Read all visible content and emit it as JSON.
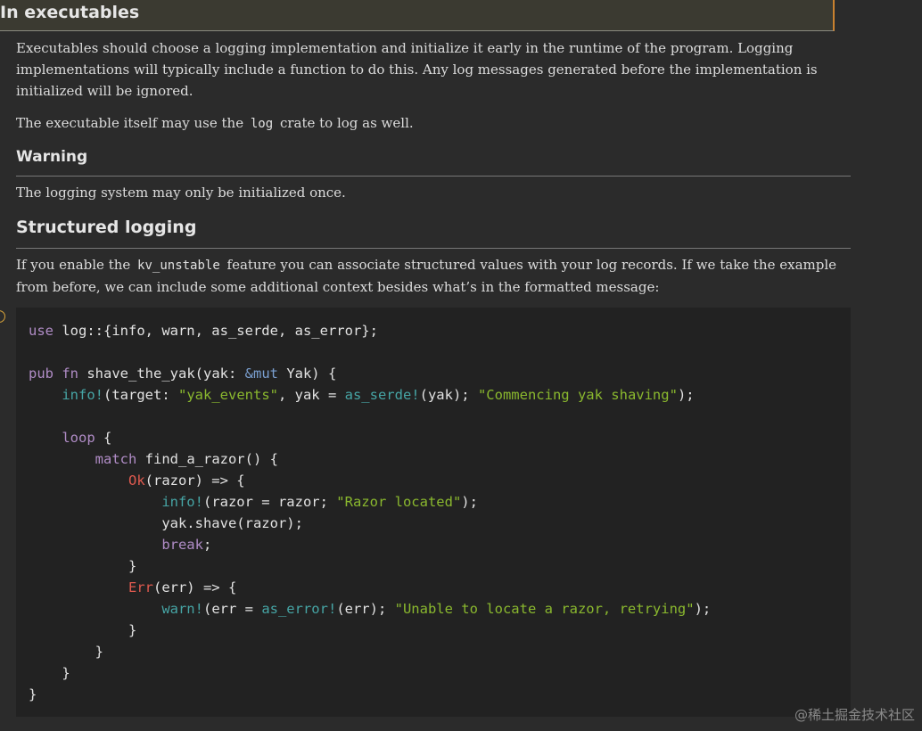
{
  "sections": {
    "executables_heading": "In executables",
    "executables_p1": "Executables should choose a logging implementation and initialize it early in the runtime of the program. Logging implementations will typically include a function to do this. Any log messages generated before the implementation is initialized will be ignored.",
    "executables_p2_before": "The executable itself may use the ",
    "executables_p2_code": "log",
    "executables_p2_after": " crate to log as well.",
    "warning_heading": "Warning",
    "warning_p": "The logging system may only be initialized once.",
    "structured_heading": "Structured logging",
    "structured_p_before": "If you enable the ",
    "structured_p_code": "kv_unstable",
    "structured_p_after": " feature you can associate structured values with your log records. If we take the example from before, we can include some additional context besides what’s in the formatted message:"
  },
  "code": {
    "l1": "use log::{info, warn, as_serde, as_error};",
    "l2_pub": "pub",
    "l2_fn": "fn",
    "l2_name": " shave_the_yak(yak: ",
    "l2_amp": "&mut",
    "l2_rest": " Yak) {",
    "l3_info": "info!",
    "l3_a": "(target: ",
    "l3_target": "\"yak_events\"",
    "l3_b": ", yak = ",
    "l3_serde": "as_serde!",
    "l3_c": "(yak); ",
    "l3_msg": "\"Commencing yak shaving\"",
    "l3_d": ");",
    "l4_loop": "loop",
    "l4_rest": " {",
    "l5_match": "match",
    "l5_rest": " find_a_razor() {",
    "l6_ok": "Ok",
    "l6_rest": "(razor) => {",
    "l7_info": "info!",
    "l7_a": "(razor = razor; ",
    "l7_msg": "\"Razor located\"",
    "l7_b": ");",
    "l8": "yak.shave(razor);",
    "l9_break": "break",
    "l9_rest": ";",
    "l10": "}",
    "l11_err": "Err",
    "l11_rest": "(err) => {",
    "l12_warn": "warn!",
    "l12_a": "(err = ",
    "l12_aserr": "as_error!",
    "l12_b": "(err); ",
    "l12_msg": "\"Unable to locate a razor, retrying\"",
    "l12_c": ");",
    "l13": "}",
    "l14": "}",
    "l15": "}",
    "l16": "}"
  },
  "watermark": "@稀土掘金技术社区"
}
